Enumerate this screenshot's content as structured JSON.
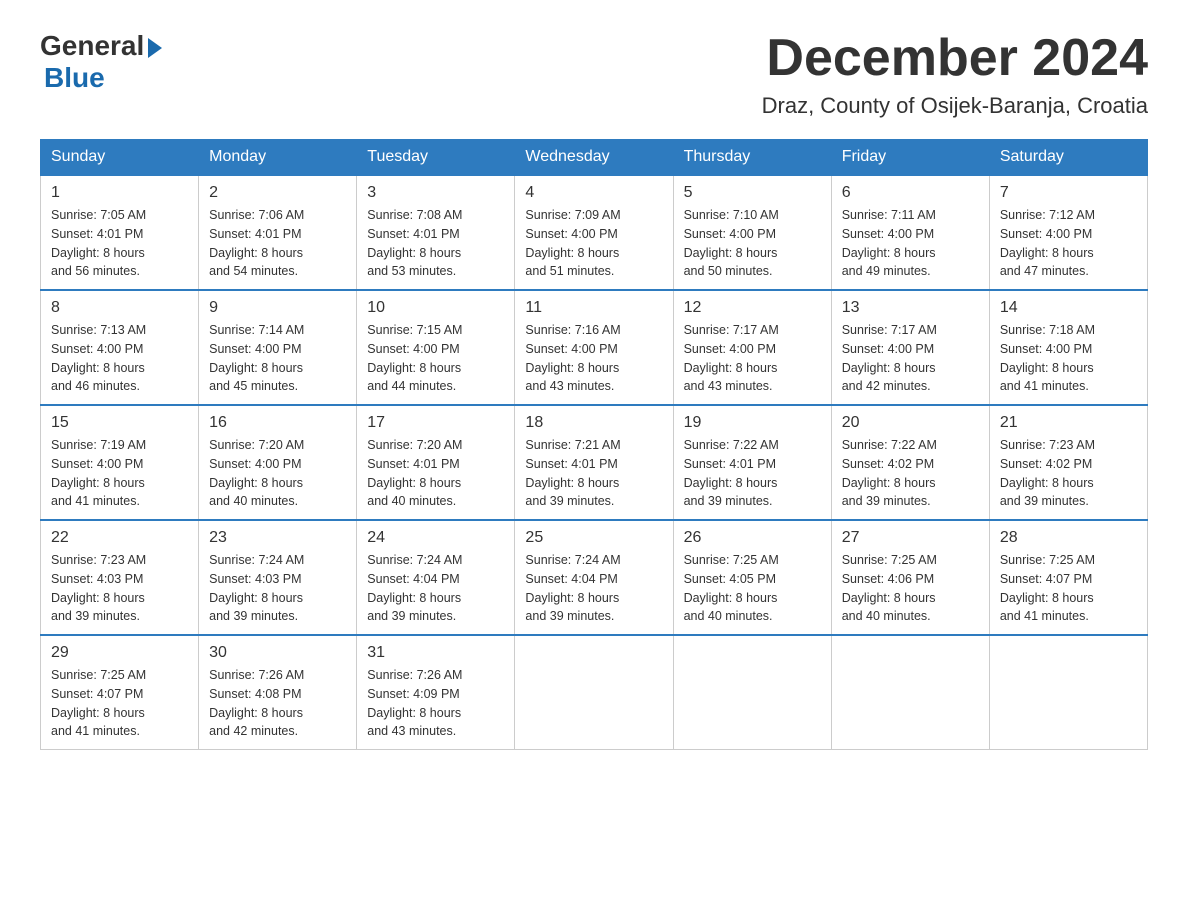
{
  "logo": {
    "general": "General",
    "blue": "Blue"
  },
  "title": "December 2024",
  "subtitle": "Draz, County of Osijek-Baranja, Croatia",
  "weekdays": [
    "Sunday",
    "Monday",
    "Tuesday",
    "Wednesday",
    "Thursday",
    "Friday",
    "Saturday"
  ],
  "weeks": [
    [
      {
        "day": "1",
        "sunrise": "7:05 AM",
        "sunset": "4:01 PM",
        "daylight": "8 hours and 56 minutes."
      },
      {
        "day": "2",
        "sunrise": "7:06 AM",
        "sunset": "4:01 PM",
        "daylight": "8 hours and 54 minutes."
      },
      {
        "day": "3",
        "sunrise": "7:08 AM",
        "sunset": "4:01 PM",
        "daylight": "8 hours and 53 minutes."
      },
      {
        "day": "4",
        "sunrise": "7:09 AM",
        "sunset": "4:00 PM",
        "daylight": "8 hours and 51 minutes."
      },
      {
        "day": "5",
        "sunrise": "7:10 AM",
        "sunset": "4:00 PM",
        "daylight": "8 hours and 50 minutes."
      },
      {
        "day": "6",
        "sunrise": "7:11 AM",
        "sunset": "4:00 PM",
        "daylight": "8 hours and 49 minutes."
      },
      {
        "day": "7",
        "sunrise": "7:12 AM",
        "sunset": "4:00 PM",
        "daylight": "8 hours and 47 minutes."
      }
    ],
    [
      {
        "day": "8",
        "sunrise": "7:13 AM",
        "sunset": "4:00 PM",
        "daylight": "8 hours and 46 minutes."
      },
      {
        "day": "9",
        "sunrise": "7:14 AM",
        "sunset": "4:00 PM",
        "daylight": "8 hours and 45 minutes."
      },
      {
        "day": "10",
        "sunrise": "7:15 AM",
        "sunset": "4:00 PM",
        "daylight": "8 hours and 44 minutes."
      },
      {
        "day": "11",
        "sunrise": "7:16 AM",
        "sunset": "4:00 PM",
        "daylight": "8 hours and 43 minutes."
      },
      {
        "day": "12",
        "sunrise": "7:17 AM",
        "sunset": "4:00 PM",
        "daylight": "8 hours and 43 minutes."
      },
      {
        "day": "13",
        "sunrise": "7:17 AM",
        "sunset": "4:00 PM",
        "daylight": "8 hours and 42 minutes."
      },
      {
        "day": "14",
        "sunrise": "7:18 AM",
        "sunset": "4:00 PM",
        "daylight": "8 hours and 41 minutes."
      }
    ],
    [
      {
        "day": "15",
        "sunrise": "7:19 AM",
        "sunset": "4:00 PM",
        "daylight": "8 hours and 41 minutes."
      },
      {
        "day": "16",
        "sunrise": "7:20 AM",
        "sunset": "4:00 PM",
        "daylight": "8 hours and 40 minutes."
      },
      {
        "day": "17",
        "sunrise": "7:20 AM",
        "sunset": "4:01 PM",
        "daylight": "8 hours and 40 minutes."
      },
      {
        "day": "18",
        "sunrise": "7:21 AM",
        "sunset": "4:01 PM",
        "daylight": "8 hours and 39 minutes."
      },
      {
        "day": "19",
        "sunrise": "7:22 AM",
        "sunset": "4:01 PM",
        "daylight": "8 hours and 39 minutes."
      },
      {
        "day": "20",
        "sunrise": "7:22 AM",
        "sunset": "4:02 PM",
        "daylight": "8 hours and 39 minutes."
      },
      {
        "day": "21",
        "sunrise": "7:23 AM",
        "sunset": "4:02 PM",
        "daylight": "8 hours and 39 minutes."
      }
    ],
    [
      {
        "day": "22",
        "sunrise": "7:23 AM",
        "sunset": "4:03 PM",
        "daylight": "8 hours and 39 minutes."
      },
      {
        "day": "23",
        "sunrise": "7:24 AM",
        "sunset": "4:03 PM",
        "daylight": "8 hours and 39 minutes."
      },
      {
        "day": "24",
        "sunrise": "7:24 AM",
        "sunset": "4:04 PM",
        "daylight": "8 hours and 39 minutes."
      },
      {
        "day": "25",
        "sunrise": "7:24 AM",
        "sunset": "4:04 PM",
        "daylight": "8 hours and 39 minutes."
      },
      {
        "day": "26",
        "sunrise": "7:25 AM",
        "sunset": "4:05 PM",
        "daylight": "8 hours and 40 minutes."
      },
      {
        "day": "27",
        "sunrise": "7:25 AM",
        "sunset": "4:06 PM",
        "daylight": "8 hours and 40 minutes."
      },
      {
        "day": "28",
        "sunrise": "7:25 AM",
        "sunset": "4:07 PM",
        "daylight": "8 hours and 41 minutes."
      }
    ],
    [
      {
        "day": "29",
        "sunrise": "7:25 AM",
        "sunset": "4:07 PM",
        "daylight": "8 hours and 41 minutes."
      },
      {
        "day": "30",
        "sunrise": "7:26 AM",
        "sunset": "4:08 PM",
        "daylight": "8 hours and 42 minutes."
      },
      {
        "day": "31",
        "sunrise": "7:26 AM",
        "sunset": "4:09 PM",
        "daylight": "8 hours and 43 minutes."
      },
      null,
      null,
      null,
      null
    ]
  ],
  "labels": {
    "sunrise": "Sunrise:",
    "sunset": "Sunset:",
    "daylight": "Daylight:"
  }
}
